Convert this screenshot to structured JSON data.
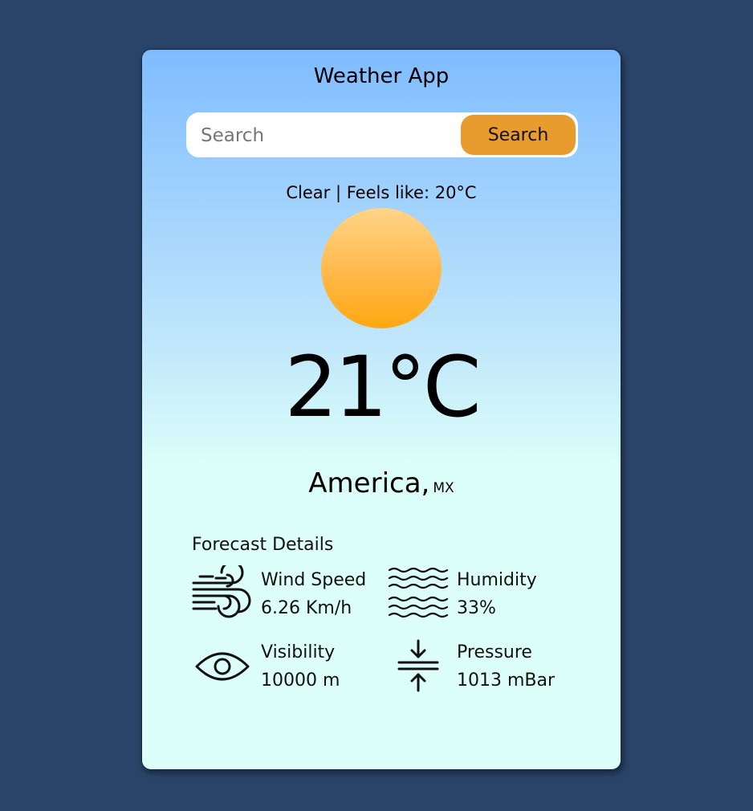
{
  "app": {
    "title": "Weather App"
  },
  "search": {
    "placeholder": "Search",
    "value": "",
    "button_label": "Search"
  },
  "current": {
    "condition_line": "Clear | Feels like: 20°C",
    "weather_icon": "sun-icon",
    "temperature": "21°C",
    "city": "America,",
    "country": "MX"
  },
  "forecast": {
    "title": "Forecast Details",
    "items": [
      {
        "label": "Wind Speed",
        "value": "6.26 Km/h",
        "icon": "wind-icon"
      },
      {
        "label": "Humidity",
        "value": "33%",
        "icon": "waves-icon"
      },
      {
        "label": "Visibility",
        "value": "10000 m",
        "icon": "eye-icon"
      },
      {
        "label": "Pressure",
        "value": "1013 mBar",
        "icon": "pressure-arrows-icon"
      }
    ]
  },
  "colors": {
    "page_background": "#2a4469",
    "accent_button": "#e89c2e",
    "sun": "#ffb84a"
  }
}
